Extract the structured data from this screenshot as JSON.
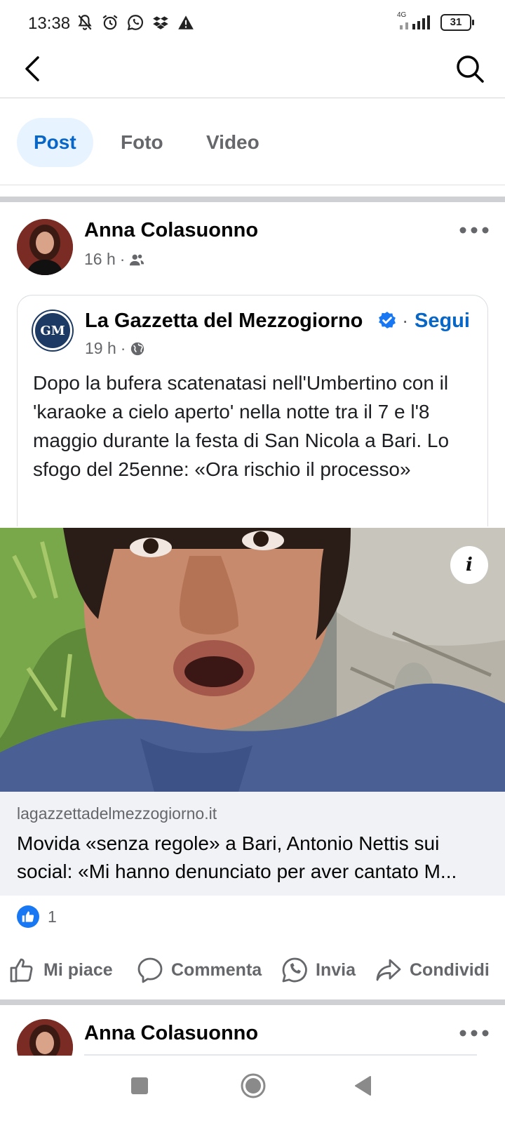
{
  "status_bar": {
    "time": "13:38",
    "network": "4G",
    "battery": "31"
  },
  "tabs": [
    {
      "label": "Post",
      "active": true
    },
    {
      "label": "Foto",
      "active": false
    },
    {
      "label": "Video",
      "active": false
    }
  ],
  "post": {
    "author": "Anna Colasuonno",
    "time": "16 h",
    "dot": "·",
    "shared": {
      "page_name": "La Gazzetta del Mezzogiorno",
      "dot": "·",
      "follow_label": "Segui",
      "time": "19 h",
      "logo_text": "GM",
      "text": "Dopo la bufera scatenatasi nell'Umbertino con il 'karaoke a cielo aperto' nella notte tra il 7 e l'8 maggio durante la festa di San Nicola a Bari. Lo sfogo del 25enne: «Ora rischio il processo»"
    },
    "link": {
      "domain": "lagazzettadelmezzogiorno.it",
      "title_line1": "Movida «senza regole» a Bari, Antonio Nettis sui",
      "title_line2": "social: «Mi hanno denunciato per aver cantato M..."
    },
    "reactions": {
      "count": "1"
    },
    "actions": {
      "like": "Mi piace",
      "comment": "Commenta",
      "send": "Invia",
      "share": "Condividi"
    }
  },
  "next_post": {
    "author": "Anna Colasuonno"
  },
  "info_label": "i",
  "colors": {
    "accent": "#0866c6",
    "tab_active_bg": "#e7f3ff",
    "secondary_text": "#65676b",
    "separator": "#ced0d4",
    "like_blue": "#1877f2"
  }
}
